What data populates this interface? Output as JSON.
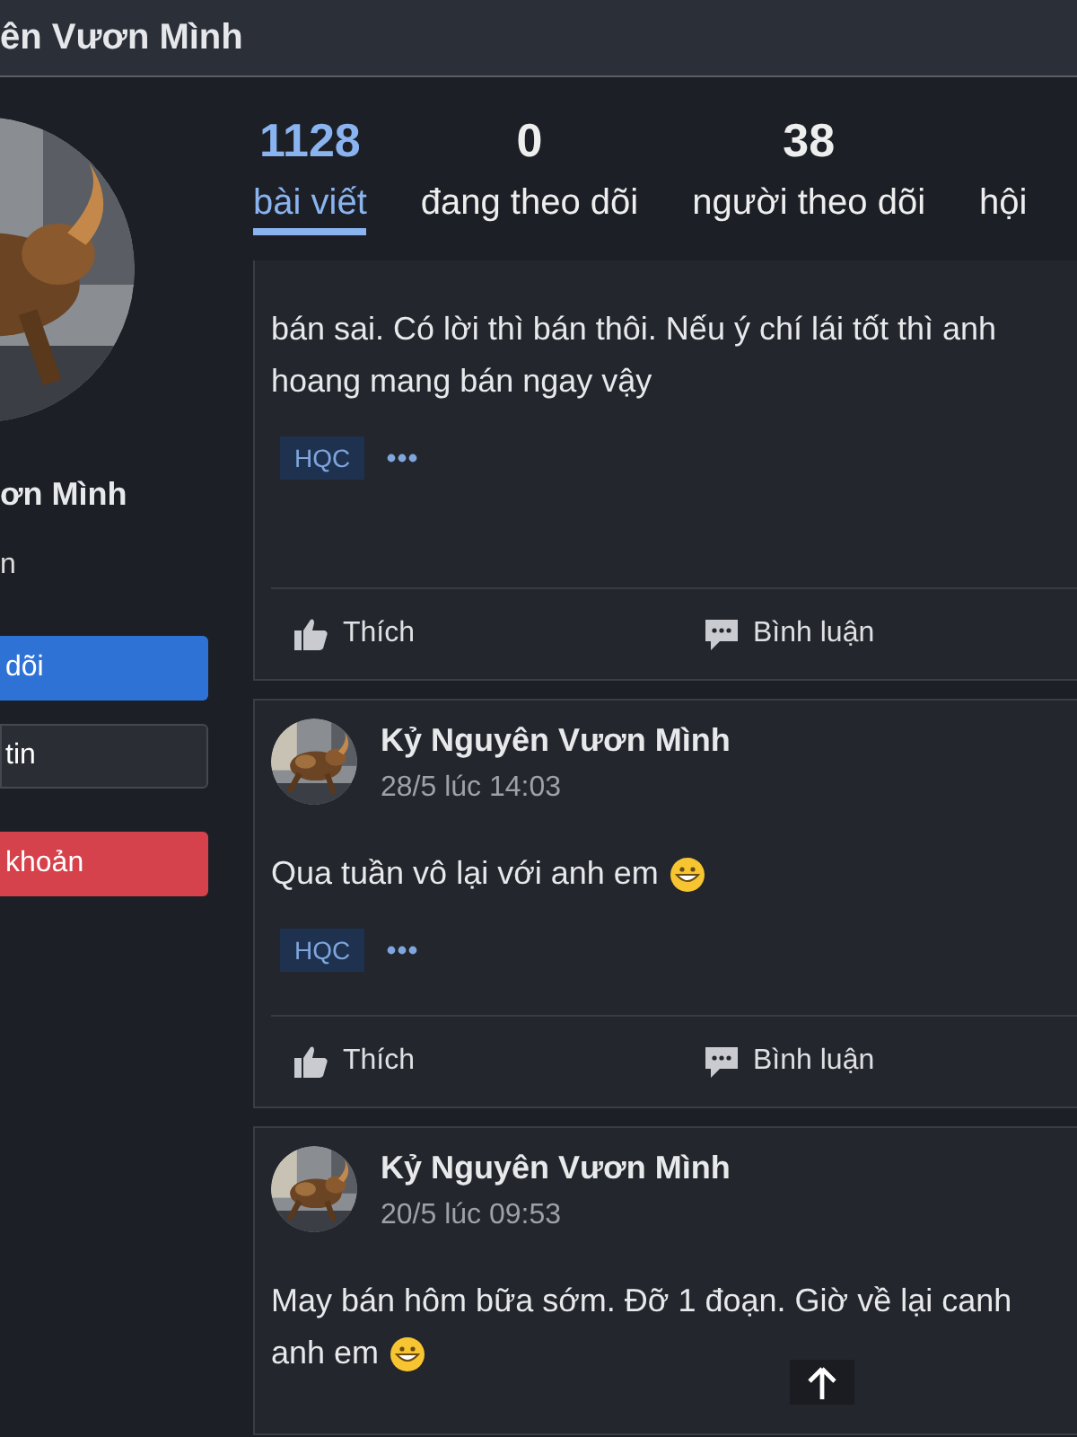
{
  "header": {
    "title": "ên Vươn Mình"
  },
  "profile": {
    "name": "ơn Mình",
    "subtitle": "n",
    "buttons": [
      {
        "label": "dõi",
        "kind": "primary"
      },
      {
        "label": "tin",
        "kind": "secondary"
      },
      {
        "label": "khoản",
        "kind": "danger"
      }
    ]
  },
  "stats": [
    {
      "count": "1128",
      "label": "bài viết",
      "selected": true
    },
    {
      "count": "0",
      "label": "đang theo dõi",
      "selected": false
    },
    {
      "count": "38",
      "label": "người theo dõi",
      "selected": false
    },
    {
      "label": "hội",
      "selected": false
    }
  ],
  "posts": [
    {
      "lines": [
        {
          "text": "bán sai. Có lời thì bán thôi. Nếu ý chí lái tốt thì anh",
          "emoji": false
        },
        {
          "text": "hoang mang bán ngay vậy",
          "emoji": false
        }
      ],
      "tags": [
        "HQC"
      ],
      "actions": [
        "Thích",
        "Bình luận"
      ]
    },
    {
      "author": "Kỷ Nguyên Vươn Mình",
      "time": "28/5 lúc 14:03",
      "lines": [
        {
          "text": "Qua tuần vô lại với anh em",
          "emoji": true
        }
      ],
      "tags": [
        "HQC"
      ],
      "actions": [
        "Thích",
        "Bình luận"
      ]
    },
    {
      "author": "Kỷ Nguyên Vươn Mình",
      "time": "20/5 lúc 09:53",
      "lines": [
        {
          "text": "May bán hôm bữa sớm. Đỡ 1 đoạn. Giờ về lại canh",
          "emoji": false
        },
        {
          "text": "anh em",
          "emoji": true
        }
      ]
    }
  ]
}
